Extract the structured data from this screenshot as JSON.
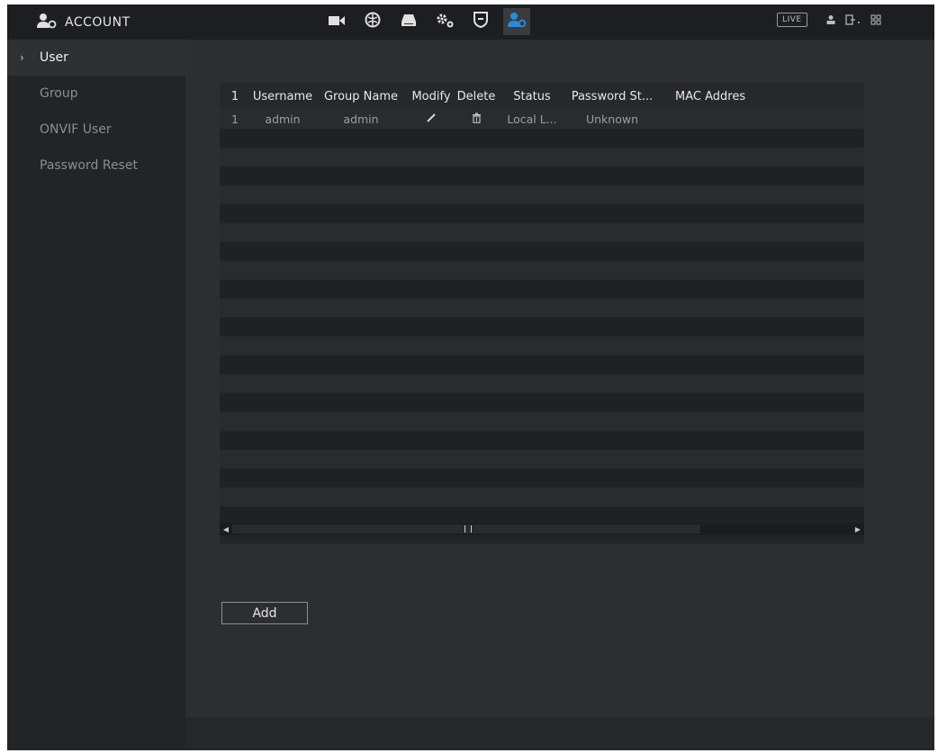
{
  "header": {
    "title": "ACCOUNT",
    "live_label": "LIVE",
    "nav_icons": [
      "camera-icon",
      "network-icon",
      "storage-icon",
      "system-icon",
      "security-icon",
      "account-icon"
    ],
    "active_nav": "account-icon"
  },
  "sidebar": {
    "items": [
      {
        "label": "User",
        "active": true
      },
      {
        "label": "Group",
        "active": false
      },
      {
        "label": "ONVIF User",
        "active": false
      },
      {
        "label": "Password Reset",
        "active": false
      }
    ]
  },
  "table": {
    "columns": [
      "1",
      "Username",
      "Group Name",
      "Modify",
      "Delete",
      "Status",
      "Password St...",
      "MAC Addres"
    ],
    "rows": [
      {
        "idx": "1",
        "username": "admin",
        "group": "admin",
        "status": "Local L...",
        "password_strength": "Unknown",
        "mac": ""
      }
    ]
  },
  "buttons": {
    "add": "Add"
  },
  "colors": {
    "accent": "#2a8cd8",
    "background": "#2d2e32",
    "sidebar": "#232427"
  }
}
